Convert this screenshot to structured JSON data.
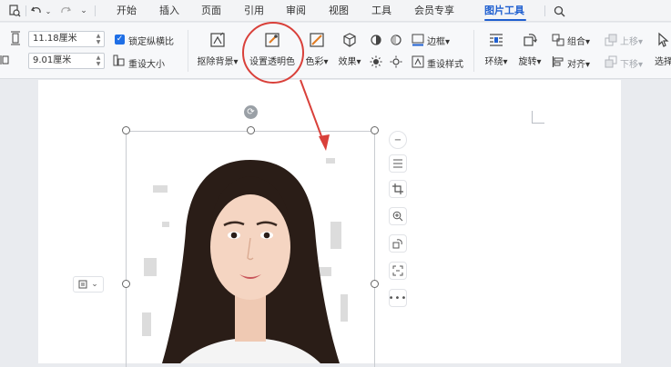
{
  "menu": {
    "tabs": [
      "开始",
      "插入",
      "页面",
      "引用",
      "审阅",
      "视图",
      "工具",
      "会员专享",
      "图片工具"
    ],
    "active_tab": "图片工具"
  },
  "size": {
    "height_value": "11.18厘米",
    "width_value": "9.01厘米",
    "lock_ratio_label": "锁定纵横比",
    "lock_ratio_checked": true,
    "reset_size_label": "重设大小"
  },
  "ribbon": {
    "remove_bg": "抠除背景",
    "set_transparent": "设置透明色",
    "color": "色彩",
    "effects": "效果",
    "border": "边框",
    "reset_style": "重设样式",
    "wrap": "环绕",
    "rotate": "旋转",
    "group": "组合",
    "align": "对齐",
    "move_up": "上移",
    "move_down": "下移",
    "select": "选择"
  },
  "colors": {
    "accent": "#1f5fd0",
    "annotation": "#d9403a"
  }
}
